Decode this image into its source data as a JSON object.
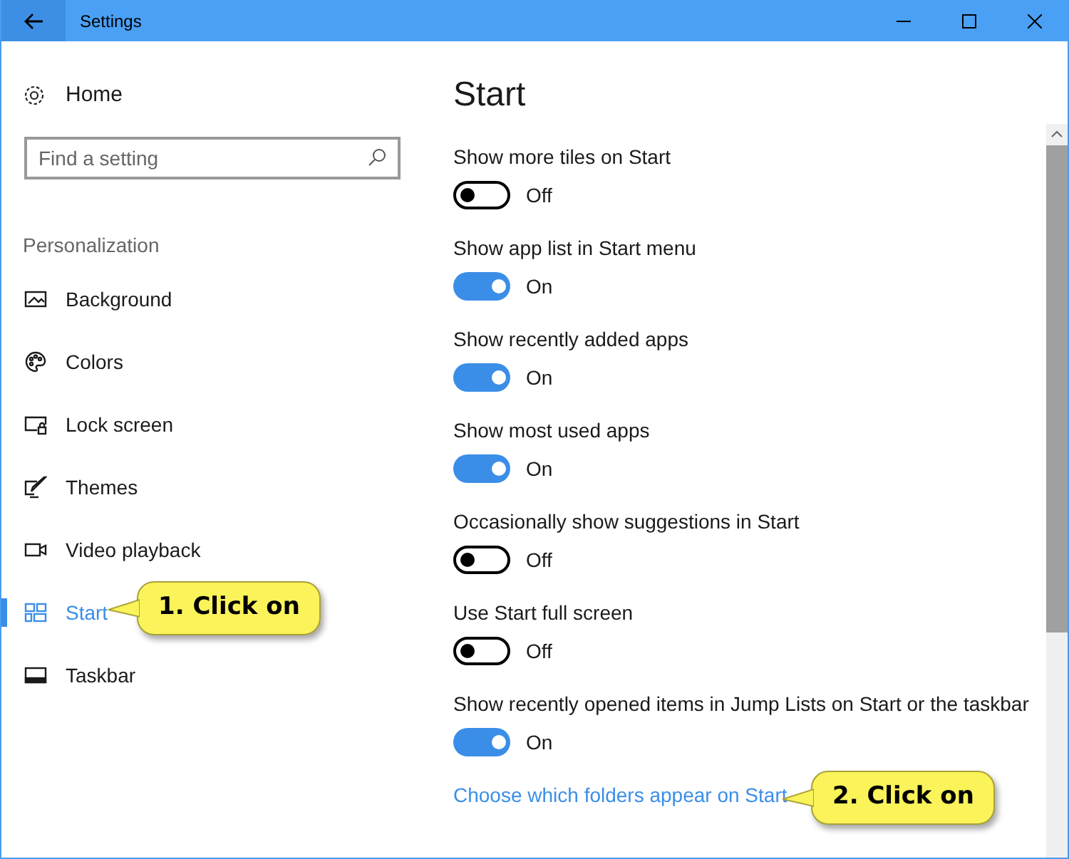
{
  "window": {
    "title": "Settings"
  },
  "sidebar": {
    "home": "Home",
    "search": {
      "placeholder": "Find a setting"
    },
    "section": "Personalization",
    "items": [
      {
        "label": "Background",
        "kind": "picture",
        "selected": false
      },
      {
        "label": "Colors",
        "kind": "palette",
        "selected": false
      },
      {
        "label": "Lock screen",
        "kind": "lock",
        "selected": false
      },
      {
        "label": "Themes",
        "kind": "brush",
        "selected": false
      },
      {
        "label": "Video playback",
        "kind": "video",
        "selected": false
      },
      {
        "label": "Start",
        "kind": "tiles",
        "selected": true
      },
      {
        "label": "Taskbar",
        "kind": "taskbar",
        "selected": false
      }
    ]
  },
  "main": {
    "heading": "Start",
    "settings": [
      {
        "label": "Show more tiles on Start",
        "on": false,
        "state_text": "Off"
      },
      {
        "label": "Show app list in Start menu",
        "on": true,
        "state_text": "On"
      },
      {
        "label": "Show recently added apps",
        "on": true,
        "state_text": "On"
      },
      {
        "label": "Show most used apps",
        "on": true,
        "state_text": "On"
      },
      {
        "label": "Occasionally show suggestions in Start",
        "on": false,
        "state_text": "Off"
      },
      {
        "label": "Use Start full screen",
        "on": false,
        "state_text": "Off"
      },
      {
        "label": "Show recently opened items in Jump Lists on Start or the taskbar",
        "on": true,
        "state_text": "On"
      }
    ],
    "link": "Choose which folders appear on Start"
  },
  "callouts": [
    "1. Click on",
    "2. Click on"
  ]
}
